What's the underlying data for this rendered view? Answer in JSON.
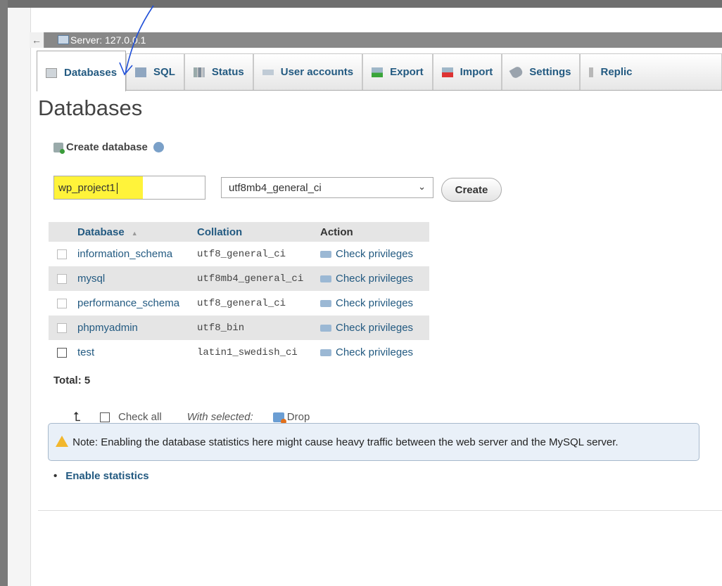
{
  "server_bar": {
    "label": "Server: 127.0.0.1",
    "collapse": "←"
  },
  "tabs": [
    {
      "label": "Databases",
      "icon": "database-icon",
      "active": true
    },
    {
      "label": "SQL",
      "icon": "sql-icon"
    },
    {
      "label": "Status",
      "icon": "status-icon"
    },
    {
      "label": "User accounts",
      "icon": "user-accounts-icon"
    },
    {
      "label": "Export",
      "icon": "export-icon"
    },
    {
      "label": "Import",
      "icon": "import-icon"
    },
    {
      "label": "Settings",
      "icon": "settings-icon"
    },
    {
      "label": "Replic",
      "icon": "replication-icon"
    }
  ],
  "page_title": "Databases",
  "create": {
    "title": "Create database",
    "db_name_value": "wp_project1",
    "collation_value": "utf8mb4_general_ci",
    "chevron": "⌄",
    "button": "Create"
  },
  "table": {
    "headers": {
      "database": "Database",
      "collation": "Collation",
      "action": "Action"
    },
    "rows": [
      {
        "name": "information_schema",
        "collation": "utf8_general_ci",
        "action": "Check privileges"
      },
      {
        "name": "mysql",
        "collation": "utf8mb4_general_ci",
        "action": "Check privileges"
      },
      {
        "name": "performance_schema",
        "collation": "utf8_general_ci",
        "action": "Check privileges"
      },
      {
        "name": "phpmyadmin",
        "collation": "utf8_bin",
        "action": "Check privileges"
      },
      {
        "name": "test",
        "collation": "latin1_swedish_ci",
        "action": "Check privileges"
      }
    ]
  },
  "total": "Total: 5",
  "bulk": {
    "check_all": "Check all",
    "with_selected": "With selected:",
    "drop": "Drop"
  },
  "notice": "Note: Enabling the database statistics here might cause heavy traffic between the web server and the MySQL server.",
  "enable_stats": {
    "bullet": "•",
    "label": "Enable statistics"
  },
  "colors": {
    "link": "#235a81",
    "highlight": "#fff33a",
    "annotation": "#1f4fd8"
  }
}
